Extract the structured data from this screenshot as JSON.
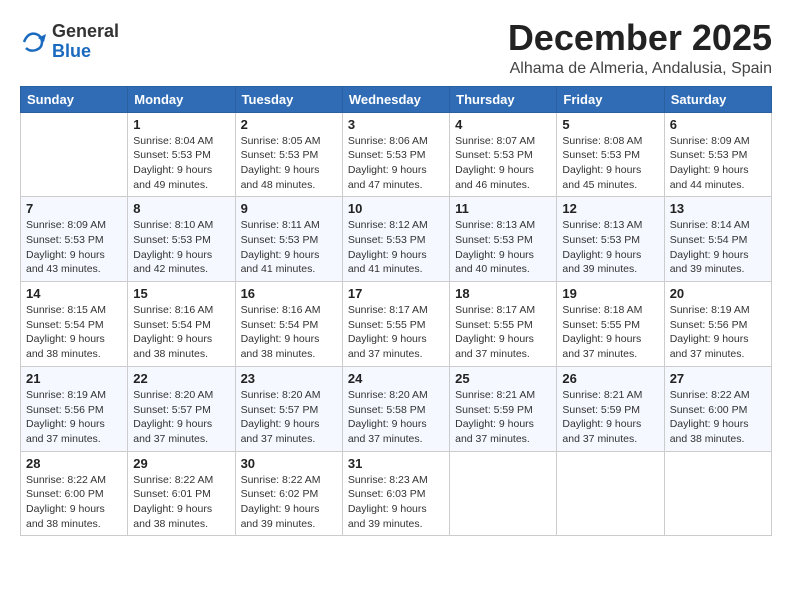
{
  "header": {
    "logo_general": "General",
    "logo_blue": "Blue",
    "title": "December 2025",
    "location": "Alhama de Almeria, Andalusia, Spain"
  },
  "days_of_week": [
    "Sunday",
    "Monday",
    "Tuesday",
    "Wednesday",
    "Thursday",
    "Friday",
    "Saturday"
  ],
  "weeks": [
    [
      {
        "day": "",
        "info": ""
      },
      {
        "day": "1",
        "info": "Sunrise: 8:04 AM\nSunset: 5:53 PM\nDaylight: 9 hours\nand 49 minutes."
      },
      {
        "day": "2",
        "info": "Sunrise: 8:05 AM\nSunset: 5:53 PM\nDaylight: 9 hours\nand 48 minutes."
      },
      {
        "day": "3",
        "info": "Sunrise: 8:06 AM\nSunset: 5:53 PM\nDaylight: 9 hours\nand 47 minutes."
      },
      {
        "day": "4",
        "info": "Sunrise: 8:07 AM\nSunset: 5:53 PM\nDaylight: 9 hours\nand 46 minutes."
      },
      {
        "day": "5",
        "info": "Sunrise: 8:08 AM\nSunset: 5:53 PM\nDaylight: 9 hours\nand 45 minutes."
      },
      {
        "day": "6",
        "info": "Sunrise: 8:09 AM\nSunset: 5:53 PM\nDaylight: 9 hours\nand 44 minutes."
      }
    ],
    [
      {
        "day": "7",
        "info": "Sunrise: 8:09 AM\nSunset: 5:53 PM\nDaylight: 9 hours\nand 43 minutes."
      },
      {
        "day": "8",
        "info": "Sunrise: 8:10 AM\nSunset: 5:53 PM\nDaylight: 9 hours\nand 42 minutes."
      },
      {
        "day": "9",
        "info": "Sunrise: 8:11 AM\nSunset: 5:53 PM\nDaylight: 9 hours\nand 41 minutes."
      },
      {
        "day": "10",
        "info": "Sunrise: 8:12 AM\nSunset: 5:53 PM\nDaylight: 9 hours\nand 41 minutes."
      },
      {
        "day": "11",
        "info": "Sunrise: 8:13 AM\nSunset: 5:53 PM\nDaylight: 9 hours\nand 40 minutes."
      },
      {
        "day": "12",
        "info": "Sunrise: 8:13 AM\nSunset: 5:53 PM\nDaylight: 9 hours\nand 39 minutes."
      },
      {
        "day": "13",
        "info": "Sunrise: 8:14 AM\nSunset: 5:54 PM\nDaylight: 9 hours\nand 39 minutes."
      }
    ],
    [
      {
        "day": "14",
        "info": "Sunrise: 8:15 AM\nSunset: 5:54 PM\nDaylight: 9 hours\nand 38 minutes."
      },
      {
        "day": "15",
        "info": "Sunrise: 8:16 AM\nSunset: 5:54 PM\nDaylight: 9 hours\nand 38 minutes."
      },
      {
        "day": "16",
        "info": "Sunrise: 8:16 AM\nSunset: 5:54 PM\nDaylight: 9 hours\nand 38 minutes."
      },
      {
        "day": "17",
        "info": "Sunrise: 8:17 AM\nSunset: 5:55 PM\nDaylight: 9 hours\nand 37 minutes."
      },
      {
        "day": "18",
        "info": "Sunrise: 8:17 AM\nSunset: 5:55 PM\nDaylight: 9 hours\nand 37 minutes."
      },
      {
        "day": "19",
        "info": "Sunrise: 8:18 AM\nSunset: 5:55 PM\nDaylight: 9 hours\nand 37 minutes."
      },
      {
        "day": "20",
        "info": "Sunrise: 8:19 AM\nSunset: 5:56 PM\nDaylight: 9 hours\nand 37 minutes."
      }
    ],
    [
      {
        "day": "21",
        "info": "Sunrise: 8:19 AM\nSunset: 5:56 PM\nDaylight: 9 hours\nand 37 minutes."
      },
      {
        "day": "22",
        "info": "Sunrise: 8:20 AM\nSunset: 5:57 PM\nDaylight: 9 hours\nand 37 minutes."
      },
      {
        "day": "23",
        "info": "Sunrise: 8:20 AM\nSunset: 5:57 PM\nDaylight: 9 hours\nand 37 minutes."
      },
      {
        "day": "24",
        "info": "Sunrise: 8:20 AM\nSunset: 5:58 PM\nDaylight: 9 hours\nand 37 minutes."
      },
      {
        "day": "25",
        "info": "Sunrise: 8:21 AM\nSunset: 5:59 PM\nDaylight: 9 hours\nand 37 minutes."
      },
      {
        "day": "26",
        "info": "Sunrise: 8:21 AM\nSunset: 5:59 PM\nDaylight: 9 hours\nand 37 minutes."
      },
      {
        "day": "27",
        "info": "Sunrise: 8:22 AM\nSunset: 6:00 PM\nDaylight: 9 hours\nand 38 minutes."
      }
    ],
    [
      {
        "day": "28",
        "info": "Sunrise: 8:22 AM\nSunset: 6:00 PM\nDaylight: 9 hours\nand 38 minutes."
      },
      {
        "day": "29",
        "info": "Sunrise: 8:22 AM\nSunset: 6:01 PM\nDaylight: 9 hours\nand 38 minutes."
      },
      {
        "day": "30",
        "info": "Sunrise: 8:22 AM\nSunset: 6:02 PM\nDaylight: 9 hours\nand 39 minutes."
      },
      {
        "day": "31",
        "info": "Sunrise: 8:23 AM\nSunset: 6:03 PM\nDaylight: 9 hours\nand 39 minutes."
      },
      {
        "day": "",
        "info": ""
      },
      {
        "day": "",
        "info": ""
      },
      {
        "day": "",
        "info": ""
      }
    ]
  ]
}
